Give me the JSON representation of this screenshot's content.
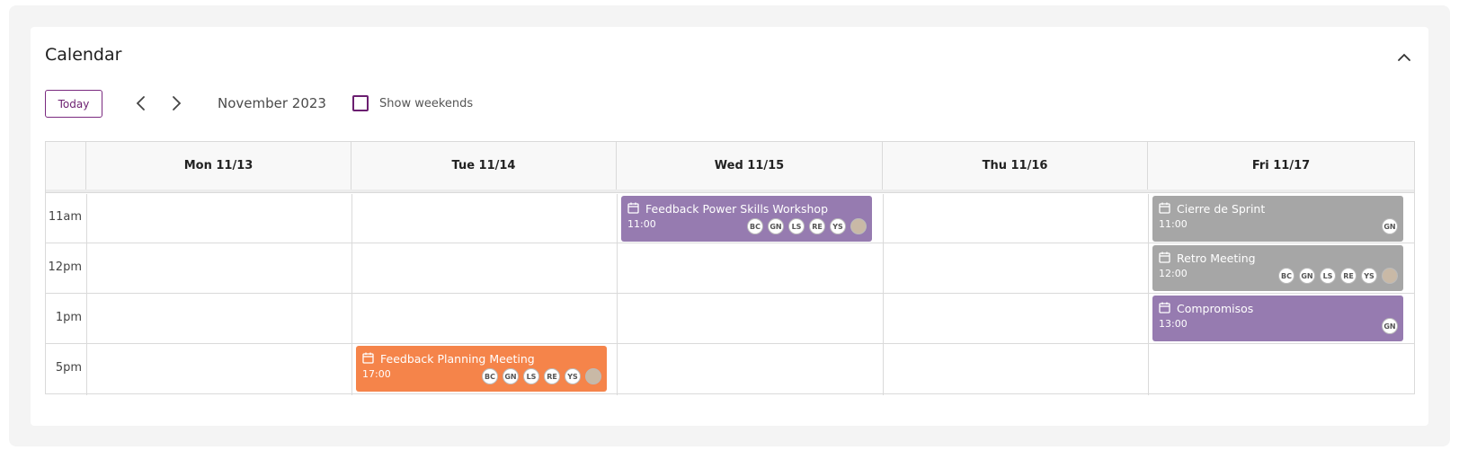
{
  "calendar": {
    "title": "Calendar",
    "today_label": "Today",
    "month_label": "November 2023",
    "show_weekends_label": "Show weekends",
    "show_weekends_checked": false,
    "days": [
      "Mon 11/13",
      "Tue 11/14",
      "Wed 11/15",
      "Thu 11/16",
      "Fri 11/17"
    ],
    "times": [
      "11am",
      "12pm",
      "1pm",
      "5pm"
    ],
    "events": [
      {
        "title": "Feedback Power Skills Workshop",
        "time": "11:00",
        "day": "Wed 11/15",
        "color": "#967bb0",
        "attendees": [
          "BC",
          "GN",
          "LS",
          "RE",
          "YS"
        ],
        "has_photo_avatar": true
      },
      {
        "title": "Cierre de Sprint",
        "time": "11:00",
        "day": "Fri 11/17",
        "color": "#a6a6a6",
        "attendees": [
          "GN"
        ],
        "has_photo_avatar": false
      },
      {
        "title": "Retro Meeting",
        "time": "12:00",
        "day": "Fri 11/17",
        "color": "#a6a6a6",
        "attendees": [
          "BC",
          "GN",
          "LS",
          "RE",
          "YS"
        ],
        "has_photo_avatar": true
      },
      {
        "title": "Compromisos",
        "time": "13:00",
        "day": "Fri 11/17",
        "color": "#967bb0",
        "attendees": [
          "GN"
        ],
        "has_photo_avatar": false
      },
      {
        "title": "Feedback Planning Meeting",
        "time": "17:00",
        "day": "Tue 11/14",
        "color": "#f5844a",
        "attendees": [
          "BC",
          "GN",
          "LS",
          "RE",
          "YS"
        ],
        "has_photo_avatar": true
      }
    ]
  },
  "colors": {
    "accent": "#6b1f70",
    "event_purple": "#967bb0",
    "event_gray": "#a6a6a6",
    "event_orange": "#f5844a"
  },
  "icons": {
    "collapse": "chevron-up-icon",
    "prev": "chevron-left-icon",
    "next": "chevron-right-icon",
    "event": "calendar-icon"
  }
}
